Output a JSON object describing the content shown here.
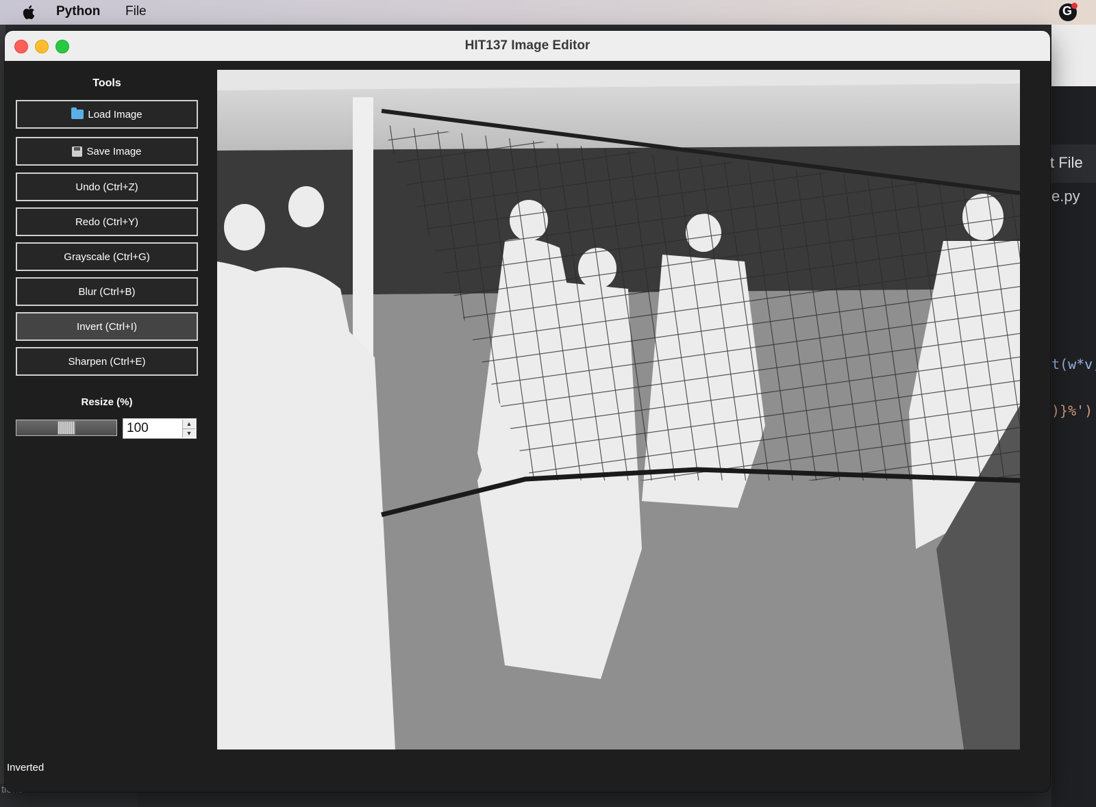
{
  "menubar": {
    "app_name": "Python",
    "file_menu": "File"
  },
  "window": {
    "title": "HIT137 Image Editor"
  },
  "sidebar": {
    "title": "Tools",
    "buttons": [
      {
        "label": "Load Image",
        "icon": "folder-icon"
      },
      {
        "label": "Save Image",
        "icon": "floppy-icon"
      },
      {
        "label": "Undo (Ctrl+Z)"
      },
      {
        "label": "Redo (Ctrl+Y)"
      },
      {
        "label": "Grayscale (Ctrl+G)"
      },
      {
        "label": "Blur (Ctrl+B)"
      },
      {
        "label": "Invert (Ctrl+I)",
        "active": true
      },
      {
        "label": "Sharpen (Ctrl+E)"
      }
    ]
  },
  "resize": {
    "label": "Resize (%)",
    "value": "100",
    "slider_fraction": 0.5
  },
  "status": {
    "text": "Inverted"
  },
  "background_editor": {
    "tab_label": "t File",
    "file_tab": "e.py",
    "code_line_1": "t(w*v,",
    "code_line_2": ")}%')",
    "bottom_text": "tions"
  },
  "colors": {
    "window_bg": "#1e1e1e",
    "button_border": "#d0d0d0",
    "active_button": "#444444",
    "close": "#fe5f57",
    "minimize": "#febc2e",
    "zoom": "#28c840"
  }
}
